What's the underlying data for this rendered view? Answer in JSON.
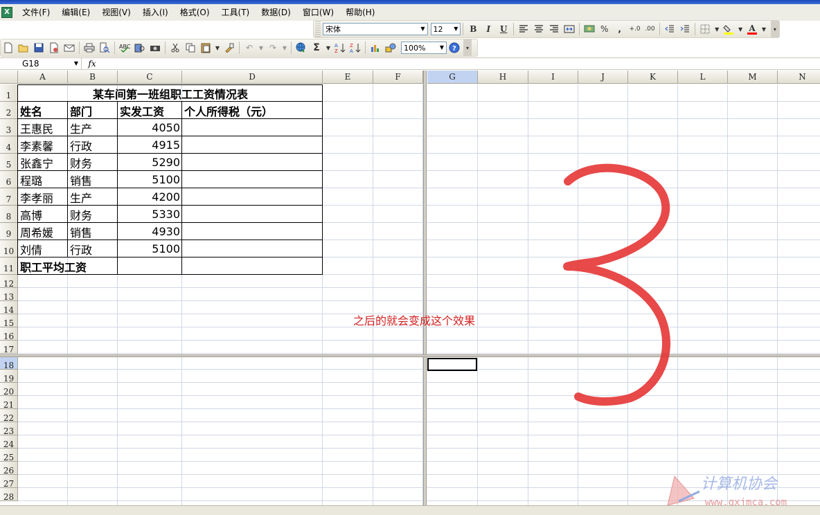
{
  "menu": [
    "文件(F)",
    "编辑(E)",
    "视图(V)",
    "插入(I)",
    "格式(O)",
    "工具(T)",
    "数据(D)",
    "窗口(W)",
    "帮助(H)"
  ],
  "format_toolbar": {
    "font_name": "宋体",
    "font_size": "12",
    "bold": "B",
    "italic": "I",
    "underline": "U",
    "percent": "%",
    "comma": ",",
    "font_color_label": "A"
  },
  "standard_toolbar": {
    "zoom": "100%",
    "sum_label": "Σ"
  },
  "formula_bar": {
    "name_box": "G18",
    "fx_label": "fx",
    "content": ""
  },
  "columns": [
    "A",
    "B",
    "C",
    "D",
    "E",
    "F",
    "G",
    "H",
    "I",
    "J",
    "K",
    "L",
    "M",
    "N"
  ],
  "rows": [
    "1",
    "2",
    "3",
    "4",
    "5",
    "6",
    "7",
    "8",
    "9",
    "10",
    "11",
    "12",
    "13",
    "14",
    "15",
    "16",
    "17",
    "18",
    "19",
    "20",
    "21",
    "22",
    "23",
    "24",
    "25",
    "26",
    "27",
    "28"
  ],
  "selected_cell": {
    "column": "G",
    "row": "18"
  },
  "sheet": {
    "title": "某车间第一班组职工工资情况表",
    "headers": [
      "姓名",
      "部门",
      "实发工资",
      "个人所得税（元）"
    ],
    "records": [
      {
        "name": "王惠民",
        "dept": "生产",
        "salary": "4050",
        "tax": ""
      },
      {
        "name": "李素馨",
        "dept": "行政",
        "salary": "4915",
        "tax": ""
      },
      {
        "name": "张鑫宁",
        "dept": "财务",
        "salary": "5290",
        "tax": ""
      },
      {
        "name": "程璐",
        "dept": "销售",
        "salary": "5100",
        "tax": ""
      },
      {
        "name": "李孝丽",
        "dept": "生产",
        "salary": "4200",
        "tax": ""
      },
      {
        "name": "高博",
        "dept": "财务",
        "salary": "5330",
        "tax": ""
      },
      {
        "name": "周希媛",
        "dept": "销售",
        "salary": "4930",
        "tax": ""
      },
      {
        "name": "刘倩",
        "dept": "行政",
        "salary": "5100",
        "tax": ""
      }
    ],
    "footer_label": "职工平均工资"
  },
  "annotation": {
    "text": "之后的就会变成这个效果",
    "drawn_number": "3",
    "color": "#e02a2a"
  },
  "watermark": {
    "title": "计算机协会",
    "url": "www.gxjmca.com"
  }
}
